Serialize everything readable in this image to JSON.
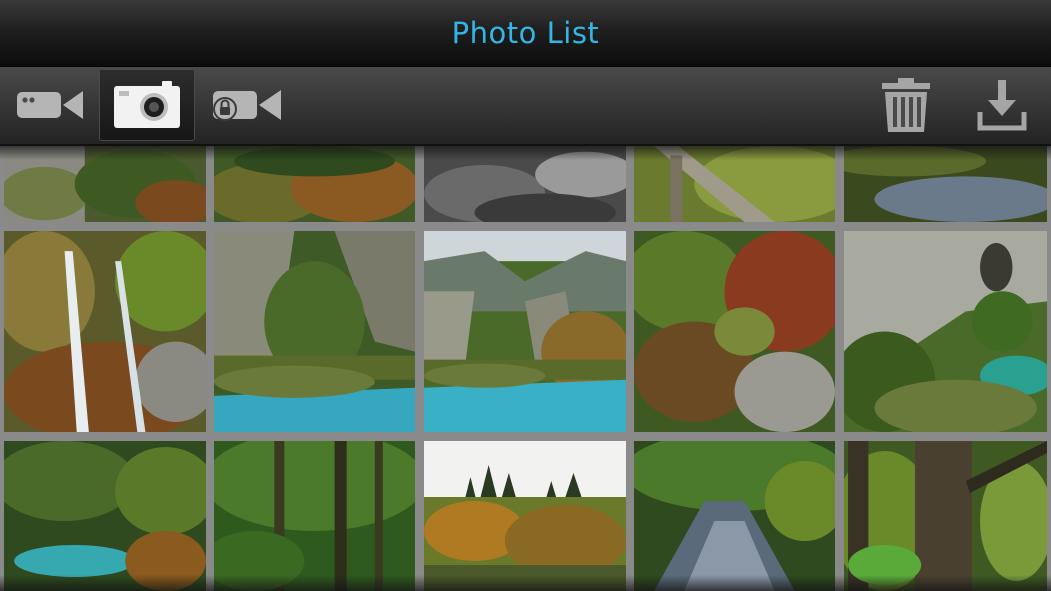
{
  "header": {
    "title": "Photo List",
    "title_color": "#33b5e5"
  },
  "toolbar": {
    "selected_mode": "photo",
    "modes": [
      {
        "id": "video",
        "icon": "video-camera-icon"
      },
      {
        "id": "photo",
        "icon": "photo-camera-icon"
      },
      {
        "id": "locked-video",
        "icon": "locked-video-camera-icon"
      }
    ],
    "actions": [
      {
        "id": "delete",
        "icon": "trash-icon"
      },
      {
        "id": "download",
        "icon": "download-icon"
      }
    ]
  },
  "photos": {
    "rows": 3,
    "columns": 5
  }
}
